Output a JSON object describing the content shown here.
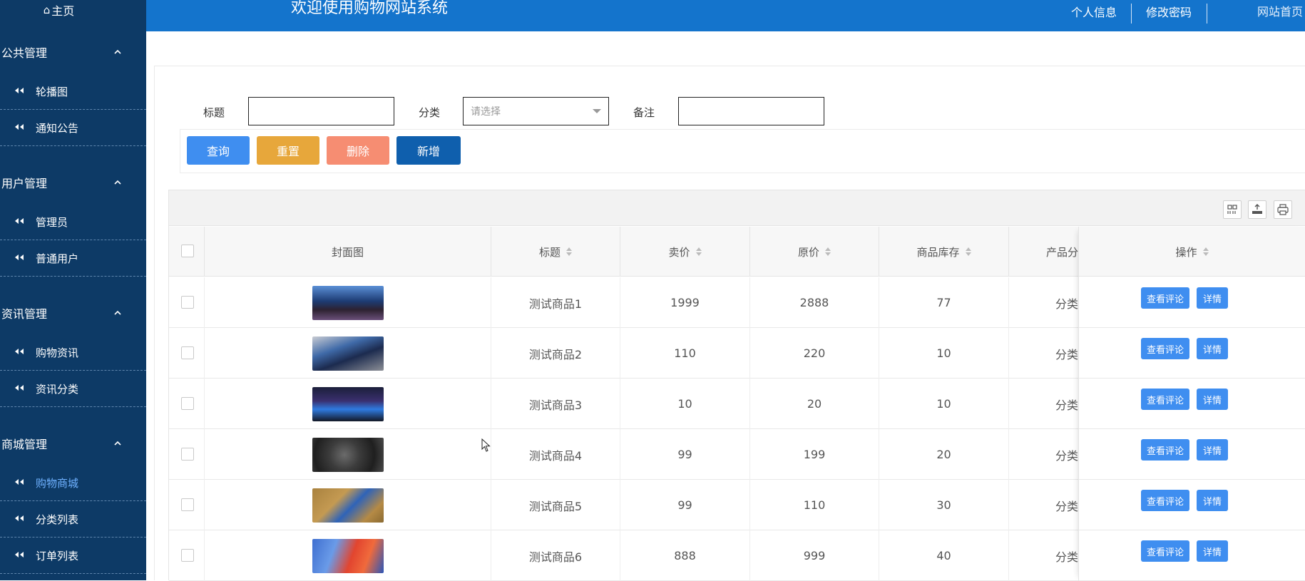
{
  "sidebar": {
    "home": "主页",
    "groups": [
      {
        "label": "公共管理",
        "items": [
          "轮播图",
          "通知公告"
        ]
      },
      {
        "label": "用户管理",
        "items": [
          "管理员",
          "普通用户"
        ]
      },
      {
        "label": "资讯管理",
        "items": [
          "购物资讯",
          "资讯分类"
        ]
      },
      {
        "label": "商城管理",
        "items": [
          "购物商城",
          "分类列表",
          "订单列表"
        ]
      }
    ],
    "active_item": "购物商城"
  },
  "header": {
    "title": "欢迎使用购物网站系统",
    "profile": "个人信息",
    "password": "修改密码",
    "site_home": "网站首页"
  },
  "filters": {
    "title_label": "标题",
    "category_label": "分类",
    "category_placeholder": "请选择",
    "remark_label": "备注"
  },
  "buttons": {
    "query": "查询",
    "reset": "重置",
    "delete": "删除",
    "add": "新增"
  },
  "colors": {
    "sidebar": "#0d3a66",
    "header": "#1474cc",
    "query": "#3f8ef0",
    "reset": "#e7a73b",
    "delete": "#f68d72",
    "add": "#0f5fad"
  },
  "table": {
    "columns": {
      "cover": "封面图",
      "title": "标题",
      "price": "卖价",
      "original": "原价",
      "stock": "商品库存",
      "category": "产品分",
      "ops": "操作"
    },
    "op_review": "查看评论",
    "op_detail": "详情",
    "rows": [
      {
        "title": "测试商品1",
        "price": "1999",
        "original": "2888",
        "stock": "77",
        "category": "分类"
      },
      {
        "title": "测试商品2",
        "price": "110",
        "original": "220",
        "stock": "10",
        "category": "分类"
      },
      {
        "title": "测试商品3",
        "price": "10",
        "original": "20",
        "stock": "10",
        "category": "分类"
      },
      {
        "title": "测试商品4",
        "price": "99",
        "original": "199",
        "stock": "20",
        "category": "分类"
      },
      {
        "title": "测试商品5",
        "price": "99",
        "original": "110",
        "stock": "30",
        "category": "分类"
      },
      {
        "title": "测试商品6",
        "price": "888",
        "original": "999",
        "stock": "40",
        "category": "分类"
      }
    ]
  }
}
